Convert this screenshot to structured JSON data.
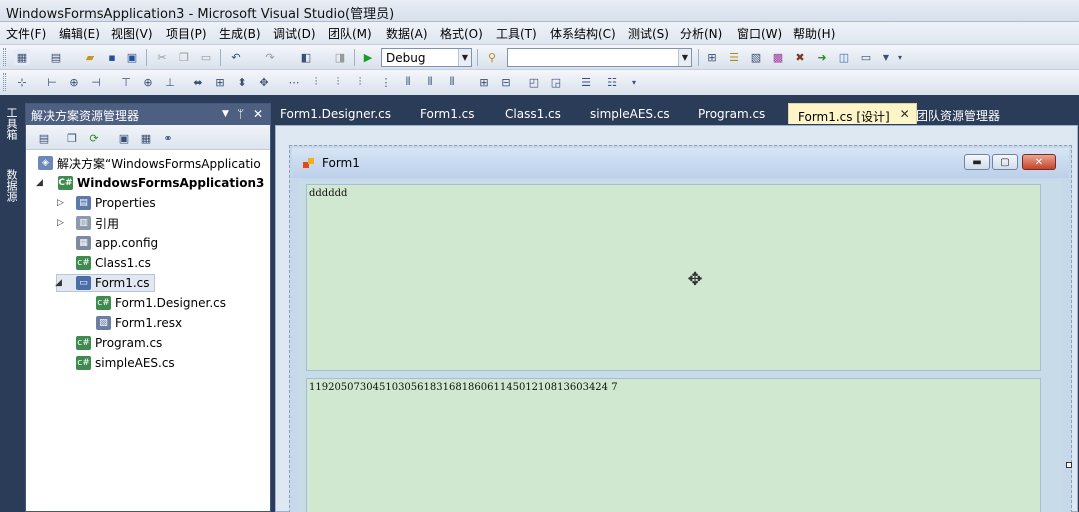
{
  "window": {
    "title": "WindowsFormsApplication3 - Microsoft Visual Studio(管理员)"
  },
  "menu": [
    "文件(F)",
    "编辑(E)",
    "视图(V)",
    "项目(P)",
    "生成(B)",
    "调试(D)",
    "团队(M)",
    "数据(A)",
    "格式(O)",
    "工具(T)",
    "体系结构(C)",
    "测试(S)",
    "分析(N)",
    "窗口(W)",
    "帮助(H)"
  ],
  "toolbar": {
    "config_value": "Debug",
    "platform_value": ""
  },
  "side_strip": {
    "toolbox": "工具箱",
    "datasource": "数据源"
  },
  "solution_explorer": {
    "title": "解决方案资源管理器",
    "pin": "ᛘ",
    "close": "✕",
    "items": [
      {
        "label": "解决方案“WindowsFormsApplicatio"
      },
      {
        "label": "WindowsFormsApplication3"
      },
      {
        "label": "Properties"
      },
      {
        "label": "引用"
      },
      {
        "label": "app.config"
      },
      {
        "label": "Class1.cs"
      },
      {
        "label": "Form1.cs"
      },
      {
        "label": "Form1.Designer.cs"
      },
      {
        "label": "Form1.resx"
      },
      {
        "label": "Program.cs"
      },
      {
        "label": "simpleAES.cs"
      }
    ]
  },
  "tabs": [
    {
      "label": "Form1.Designer.cs"
    },
    {
      "label": "Form1.cs"
    },
    {
      "label": "Class1.cs"
    },
    {
      "label": "simpleAES.cs"
    },
    {
      "label": "Program.cs"
    },
    {
      "label": "Form1.cs [设计]"
    },
    {
      "label": "团队资源管理器"
    }
  ],
  "form": {
    "title": "Form1",
    "textbox1": "dddddd",
    "textbox2": "11920507304510305618316818606114501210813603424 7"
  },
  "colors": {
    "chrome": "#2b3c59",
    "textbox_bg": "#cfe8cf",
    "active_tab": "#fdf5c8"
  }
}
